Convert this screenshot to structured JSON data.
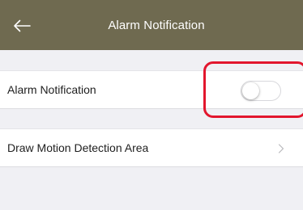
{
  "header": {
    "title": "Alarm Notification",
    "back_icon": "arrow-left-icon",
    "background_color": "#6f6a50"
  },
  "settings": [
    {
      "label": "Alarm Notification",
      "control": "toggle",
      "enabled": false
    },
    {
      "label": "Draw Motion Detection Area",
      "control": "chevron",
      "icon": "chevron-right-icon"
    }
  ],
  "annotation": {
    "highlight_color": "#e2162d"
  }
}
